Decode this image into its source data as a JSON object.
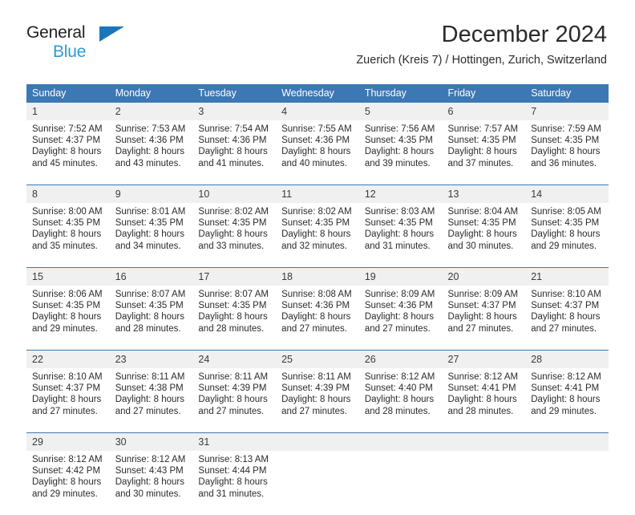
{
  "brand": {
    "name_part1": "General",
    "name_part2": "Blue",
    "triangle_color": "#1b75bb",
    "accent_color": "#2e9bd6"
  },
  "header": {
    "title": "December 2024",
    "subtitle": "Zuerich (Kreis 7) / Hottingen, Zurich, Switzerland"
  },
  "theme": {
    "header_blue": "#3c78b4",
    "day_band_gray": "#f0f0f0",
    "text_color": "#2b2b2b"
  },
  "weekdays": [
    "Sunday",
    "Monday",
    "Tuesday",
    "Wednesday",
    "Thursday",
    "Friday",
    "Saturday"
  ],
  "weeks": [
    {
      "days": [
        {
          "num": "1",
          "sunrise": "Sunrise: 7:52 AM",
          "sunset": "Sunset: 4:37 PM",
          "daylight1": "Daylight: 8 hours",
          "daylight2": "and 45 minutes."
        },
        {
          "num": "2",
          "sunrise": "Sunrise: 7:53 AM",
          "sunset": "Sunset: 4:36 PM",
          "daylight1": "Daylight: 8 hours",
          "daylight2": "and 43 minutes."
        },
        {
          "num": "3",
          "sunrise": "Sunrise: 7:54 AM",
          "sunset": "Sunset: 4:36 PM",
          "daylight1": "Daylight: 8 hours",
          "daylight2": "and 41 minutes."
        },
        {
          "num": "4",
          "sunrise": "Sunrise: 7:55 AM",
          "sunset": "Sunset: 4:36 PM",
          "daylight1": "Daylight: 8 hours",
          "daylight2": "and 40 minutes."
        },
        {
          "num": "5",
          "sunrise": "Sunrise: 7:56 AM",
          "sunset": "Sunset: 4:35 PM",
          "daylight1": "Daylight: 8 hours",
          "daylight2": "and 39 minutes."
        },
        {
          "num": "6",
          "sunrise": "Sunrise: 7:57 AM",
          "sunset": "Sunset: 4:35 PM",
          "daylight1": "Daylight: 8 hours",
          "daylight2": "and 37 minutes."
        },
        {
          "num": "7",
          "sunrise": "Sunrise: 7:59 AM",
          "sunset": "Sunset: 4:35 PM",
          "daylight1": "Daylight: 8 hours",
          "daylight2": "and 36 minutes."
        }
      ]
    },
    {
      "days": [
        {
          "num": "8",
          "sunrise": "Sunrise: 8:00 AM",
          "sunset": "Sunset: 4:35 PM",
          "daylight1": "Daylight: 8 hours",
          "daylight2": "and 35 minutes."
        },
        {
          "num": "9",
          "sunrise": "Sunrise: 8:01 AM",
          "sunset": "Sunset: 4:35 PM",
          "daylight1": "Daylight: 8 hours",
          "daylight2": "and 34 minutes."
        },
        {
          "num": "10",
          "sunrise": "Sunrise: 8:02 AM",
          "sunset": "Sunset: 4:35 PM",
          "daylight1": "Daylight: 8 hours",
          "daylight2": "and 33 minutes."
        },
        {
          "num": "11",
          "sunrise": "Sunrise: 8:02 AM",
          "sunset": "Sunset: 4:35 PM",
          "daylight1": "Daylight: 8 hours",
          "daylight2": "and 32 minutes."
        },
        {
          "num": "12",
          "sunrise": "Sunrise: 8:03 AM",
          "sunset": "Sunset: 4:35 PM",
          "daylight1": "Daylight: 8 hours",
          "daylight2": "and 31 minutes."
        },
        {
          "num": "13",
          "sunrise": "Sunrise: 8:04 AM",
          "sunset": "Sunset: 4:35 PM",
          "daylight1": "Daylight: 8 hours",
          "daylight2": "and 30 minutes."
        },
        {
          "num": "14",
          "sunrise": "Sunrise: 8:05 AM",
          "sunset": "Sunset: 4:35 PM",
          "daylight1": "Daylight: 8 hours",
          "daylight2": "and 29 minutes."
        }
      ]
    },
    {
      "days": [
        {
          "num": "15",
          "sunrise": "Sunrise: 8:06 AM",
          "sunset": "Sunset: 4:35 PM",
          "daylight1": "Daylight: 8 hours",
          "daylight2": "and 29 minutes."
        },
        {
          "num": "16",
          "sunrise": "Sunrise: 8:07 AM",
          "sunset": "Sunset: 4:35 PM",
          "daylight1": "Daylight: 8 hours",
          "daylight2": "and 28 minutes."
        },
        {
          "num": "17",
          "sunrise": "Sunrise: 8:07 AM",
          "sunset": "Sunset: 4:35 PM",
          "daylight1": "Daylight: 8 hours",
          "daylight2": "and 28 minutes."
        },
        {
          "num": "18",
          "sunrise": "Sunrise: 8:08 AM",
          "sunset": "Sunset: 4:36 PM",
          "daylight1": "Daylight: 8 hours",
          "daylight2": "and 27 minutes."
        },
        {
          "num": "19",
          "sunrise": "Sunrise: 8:09 AM",
          "sunset": "Sunset: 4:36 PM",
          "daylight1": "Daylight: 8 hours",
          "daylight2": "and 27 minutes."
        },
        {
          "num": "20",
          "sunrise": "Sunrise: 8:09 AM",
          "sunset": "Sunset: 4:37 PM",
          "daylight1": "Daylight: 8 hours",
          "daylight2": "and 27 minutes."
        },
        {
          "num": "21",
          "sunrise": "Sunrise: 8:10 AM",
          "sunset": "Sunset: 4:37 PM",
          "daylight1": "Daylight: 8 hours",
          "daylight2": "and 27 minutes."
        }
      ]
    },
    {
      "days": [
        {
          "num": "22",
          "sunrise": "Sunrise: 8:10 AM",
          "sunset": "Sunset: 4:37 PM",
          "daylight1": "Daylight: 8 hours",
          "daylight2": "and 27 minutes."
        },
        {
          "num": "23",
          "sunrise": "Sunrise: 8:11 AM",
          "sunset": "Sunset: 4:38 PM",
          "daylight1": "Daylight: 8 hours",
          "daylight2": "and 27 minutes."
        },
        {
          "num": "24",
          "sunrise": "Sunrise: 8:11 AM",
          "sunset": "Sunset: 4:39 PM",
          "daylight1": "Daylight: 8 hours",
          "daylight2": "and 27 minutes."
        },
        {
          "num": "25",
          "sunrise": "Sunrise: 8:11 AM",
          "sunset": "Sunset: 4:39 PM",
          "daylight1": "Daylight: 8 hours",
          "daylight2": "and 27 minutes."
        },
        {
          "num": "26",
          "sunrise": "Sunrise: 8:12 AM",
          "sunset": "Sunset: 4:40 PM",
          "daylight1": "Daylight: 8 hours",
          "daylight2": "and 28 minutes."
        },
        {
          "num": "27",
          "sunrise": "Sunrise: 8:12 AM",
          "sunset": "Sunset: 4:41 PM",
          "daylight1": "Daylight: 8 hours",
          "daylight2": "and 28 minutes."
        },
        {
          "num": "28",
          "sunrise": "Sunrise: 8:12 AM",
          "sunset": "Sunset: 4:41 PM",
          "daylight1": "Daylight: 8 hours",
          "daylight2": "and 29 minutes."
        }
      ]
    },
    {
      "days": [
        {
          "num": "29",
          "sunrise": "Sunrise: 8:12 AM",
          "sunset": "Sunset: 4:42 PM",
          "daylight1": "Daylight: 8 hours",
          "daylight2": "and 29 minutes."
        },
        {
          "num": "30",
          "sunrise": "Sunrise: 8:12 AM",
          "sunset": "Sunset: 4:43 PM",
          "daylight1": "Daylight: 8 hours",
          "daylight2": "and 30 minutes."
        },
        {
          "num": "31",
          "sunrise": "Sunrise: 8:13 AM",
          "sunset": "Sunset: 4:44 PM",
          "daylight1": "Daylight: 8 hours",
          "daylight2": "and 31 minutes."
        },
        {
          "num": "",
          "sunrise": "",
          "sunset": "",
          "daylight1": "",
          "daylight2": ""
        },
        {
          "num": "",
          "sunrise": "",
          "sunset": "",
          "daylight1": "",
          "daylight2": ""
        },
        {
          "num": "",
          "sunrise": "",
          "sunset": "",
          "daylight1": "",
          "daylight2": ""
        },
        {
          "num": "",
          "sunrise": "",
          "sunset": "",
          "daylight1": "",
          "daylight2": ""
        }
      ]
    }
  ]
}
